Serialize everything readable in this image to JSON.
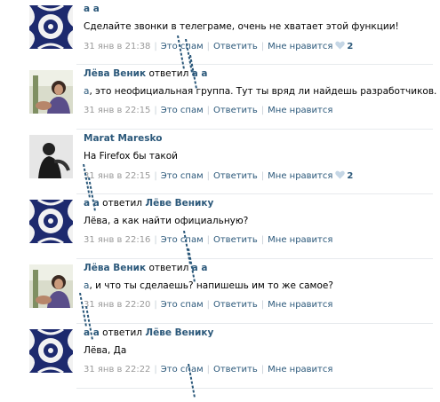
{
  "comments": [
    {
      "author": "а а",
      "replied_word": "",
      "reply_to": "",
      "mention": "",
      "text": "Сделайте звонки в телеграме, очень не хватает этой функции!",
      "date": "31 янв в 21:38",
      "spam": "Это спам",
      "reply": "Ответить",
      "like": "Мне нравится",
      "likes": "2",
      "avatar_icon": "pattern-avatar-icon"
    },
    {
      "author": "Лёва Веник",
      "replied_word": "ответил",
      "reply_to": "а а",
      "mention": "а",
      "text": ", это неофициальная группа. Тут ты вряд ли найдешь разработчиков.",
      "date": "31 янв в 22:15",
      "spam": "Это спам",
      "reply": "Ответить",
      "like": "Мне нравится",
      "likes": "",
      "avatar_icon": "photo-avatar-icon"
    },
    {
      "author": "Marat Maresko",
      "replied_word": "",
      "reply_to": "",
      "mention": "",
      "text": "На Firefox бы такой",
      "date": "31 янв в 22:15",
      "spam": "Это спам",
      "reply": "Ответить",
      "like": "Мне нравится",
      "likes": "2",
      "avatar_icon": "bw-photo-avatar-icon"
    },
    {
      "author": "а а",
      "replied_word": "ответил",
      "reply_to": "Лёве Венику",
      "mention": "",
      "text": "Лёва, а как найти официальную?",
      "date": "31 янв в 22:16",
      "spam": "Это спам",
      "reply": "Ответить",
      "like": "Мне нравится",
      "likes": "",
      "avatar_icon": "pattern-avatar-icon"
    },
    {
      "author": "Лёва Веник",
      "replied_word": "ответил",
      "reply_to": "а а",
      "mention": "а",
      "text": ", и что ты сделаешь? напишешь им то же самое?",
      "date": "31 янв в 22:20",
      "spam": "Это спам",
      "reply": "Ответить",
      "like": "Мне нравится",
      "likes": "",
      "avatar_icon": "photo-avatar-icon"
    },
    {
      "author": "а а",
      "replied_word": "ответил",
      "reply_to": "Лёве Венику",
      "mention": "",
      "text": "Лёва, Да",
      "date": "31 янв в 22:22",
      "spam": "Это спам",
      "reply": "Ответить",
      "like": "Мне нравится",
      "likes": "",
      "avatar_icon": "pattern-avatar-icon"
    }
  ],
  "colors": {
    "link": "#2b587a",
    "meta": "#999999",
    "divider": "#e7eaed",
    "heart": "#c5d6e5"
  }
}
